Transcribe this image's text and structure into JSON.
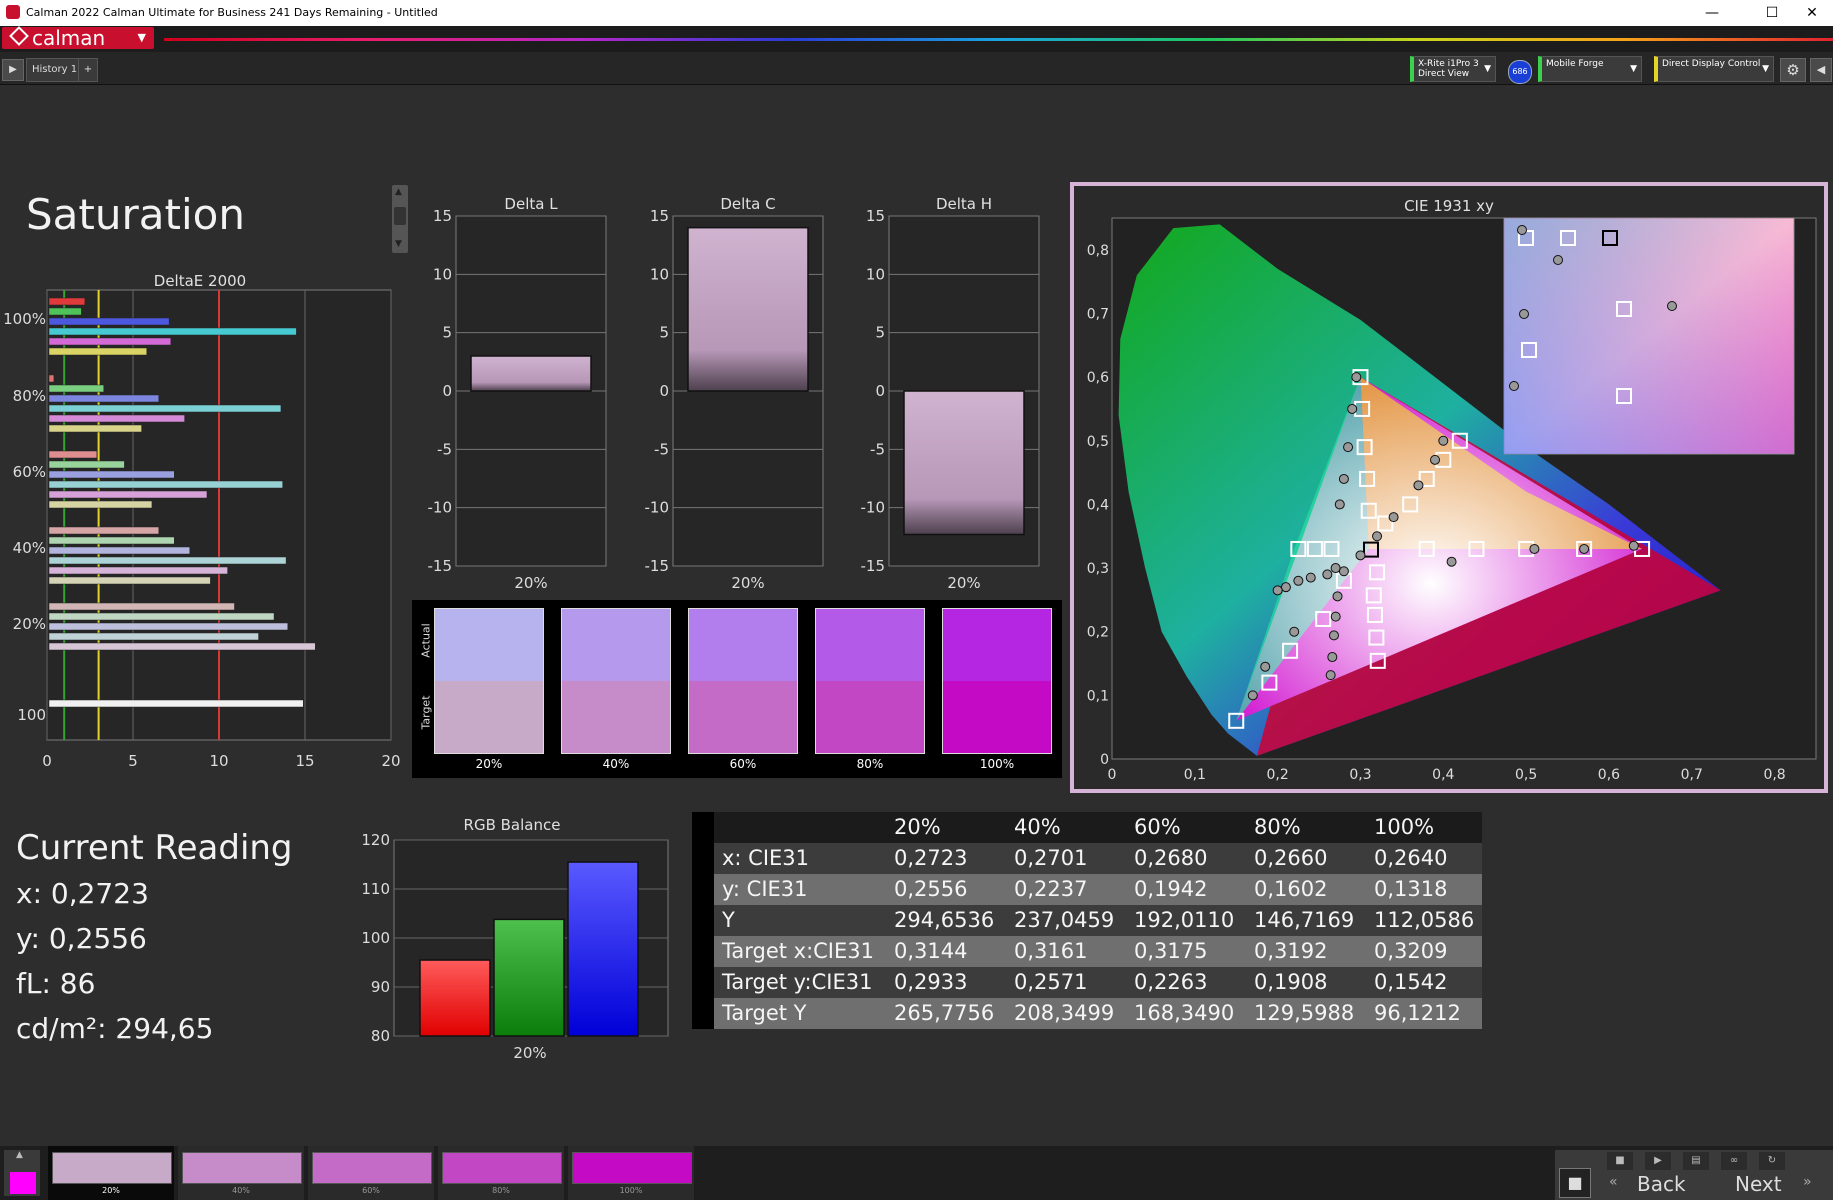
{
  "window": {
    "title": "Calman 2022 Calman Ultimate for Business 241 Days Remaining  - Untitled",
    "minimize": "—",
    "maximize": "☐",
    "close": "✕"
  },
  "brand": {
    "logo_text": "calman"
  },
  "tabs": {
    "history": "History 1",
    "add": "+"
  },
  "devices": {
    "meter_line1": "X-Rite i1Pro 3",
    "meter_line2": "Direct View",
    "meter_badge": "686",
    "source": "Mobile Forge",
    "display": "Direct Display Control"
  },
  "page": {
    "title": "Saturation"
  },
  "deltae": {
    "title": "DeltaE 2000",
    "xticks": [
      "0",
      "5",
      "10",
      "15",
      "20"
    ],
    "ylabels": [
      "100%",
      "80%",
      "60%",
      "40%",
      "20%",
      "100"
    ]
  },
  "delta_l": {
    "title": "Delta L",
    "label": "20%",
    "value": 3
  },
  "delta_c": {
    "title": "Delta C",
    "label": "20%",
    "value": 14
  },
  "delta_h": {
    "title": "Delta H",
    "label": "20%",
    "value": -12.3
  },
  "delta_axis": {
    "ticks": [
      "15",
      "10",
      "5",
      "0",
      "-5",
      "-10",
      "-15"
    ]
  },
  "swatches": {
    "actual_label": "Actual",
    "target_label": "Target",
    "items": [
      {
        "label": "20%",
        "actual": "#b7b3ee",
        "target": "#c6aac8"
      },
      {
        "label": "40%",
        "actual": "#b499ec",
        "target": "#c68cc9"
      },
      {
        "label": "60%",
        "actual": "#b27ded",
        "target": "#c46ac7"
      },
      {
        "label": "80%",
        "actual": "#b35ae9",
        "target": "#c247c4"
      },
      {
        "label": "100%",
        "actual": "#b526e3",
        "target": "#c40ac4"
      }
    ]
  },
  "cie": {
    "title": "CIE 1931 xy",
    "xticks": [
      "0",
      "0,1",
      "0,2",
      "0,3",
      "0,4",
      "0,5",
      "0,6",
      "0,7",
      "0,8"
    ],
    "yticks": [
      "0",
      "0,1",
      "0,2",
      "0,3",
      "0,4",
      "0,5",
      "0,6",
      "0,7",
      "0,8"
    ]
  },
  "current": {
    "title": "Current Reading",
    "x": "x: 0,2723",
    "y": "y: 0,2556",
    "fl": "fL: 86",
    "cdm": "cd/m²: 294,65"
  },
  "rgb": {
    "title": "RGB Balance",
    "label": "20%",
    "yticks": [
      "120",
      "110",
      "100",
      "90",
      "80"
    ],
    "ylim": [
      80,
      120
    ],
    "values": {
      "r": 95.5,
      "g": 103.8,
      "b": 115.5
    }
  },
  "table": {
    "headers": [
      "",
      "20%",
      "40%",
      "60%",
      "80%",
      "100%"
    ],
    "rows": [
      [
        "x: CIE31",
        "0,2723",
        "0,2701",
        "0,2680",
        "0,2660",
        "0,2640"
      ],
      [
        "y: CIE31",
        "0,2556",
        "0,2237",
        "0,1942",
        "0,1602",
        "0,1318"
      ],
      [
        "Y",
        "294,6536",
        "237,0459",
        "192,0110",
        "146,7169",
        "112,0586"
      ],
      [
        "Target x:CIE31",
        "0,3144",
        "0,3161",
        "0,3175",
        "0,3192",
        "0,3209"
      ],
      [
        "Target y:CIE31",
        "0,2933",
        "0,2571",
        "0,2263",
        "0,1908",
        "0,1542"
      ],
      [
        "Target Y",
        "265,7756",
        "208,3499",
        "168,3490",
        "129,5988",
        "96,1212"
      ]
    ]
  },
  "filmstrip": {
    "items": [
      {
        "label": "20%",
        "color": "#c6aac8"
      },
      {
        "label": "40%",
        "color": "#c68cc9"
      },
      {
        "label": "60%",
        "color": "#c46ac7"
      },
      {
        "label": "80%",
        "color": "#c247c4"
      },
      {
        "label": "100%",
        "color": "#c40ac4"
      }
    ]
  },
  "nav": {
    "back": "Back",
    "next": "Next"
  },
  "chart_data": [
    {
      "type": "bar",
      "title": "DeltaE 2000",
      "orientation": "horizontal",
      "xlim": [
        0,
        20
      ],
      "groups": [
        {
          "label": "100%",
          "values": [
            2.2,
            2.0,
            7.1,
            14.5,
            7.2,
            5.8
          ],
          "colors": [
            "#e03a3a",
            "#4fc35a",
            "#4c58e0",
            "#46c9d0",
            "#d36ad6",
            "#d9d465"
          ]
        },
        {
          "label": "80%",
          "values": [
            0.4,
            3.3,
            6.5,
            13.6,
            8.0,
            5.5
          ],
          "colors": [
            "#e07272",
            "#79cf7f",
            "#7d86df",
            "#7bd0d4",
            "#d48ad6",
            "#d8d48a"
          ]
        },
        {
          "label": "60%",
          "values": [
            2.9,
            4.5,
            7.4,
            13.7,
            9.3,
            6.1
          ],
          "colors": [
            "#de8e8e",
            "#97d39b",
            "#9aa0df",
            "#98d1d4",
            "#d6a1d8",
            "#d6d4a2"
          ]
        },
        {
          "label": "40%",
          "values": [
            6.5,
            7.4,
            8.3,
            13.9,
            10.5,
            9.5
          ],
          "colors": [
            "#d6a6a6",
            "#acd5b0",
            "#b1b4dc",
            "#acd3d6",
            "#d6b3d8",
            "#d5d3b5"
          ]
        },
        {
          "label": "20%",
          "values": [
            10.9,
            13.2,
            14.0,
            12.3,
            15.6
          ],
          "colors": [
            "#d2b6b6",
            "#bfd7c2",
            "#bdbfdc",
            "#bfd3d6",
            "#d6c6d6"
          ]
        },
        {
          "label": "100",
          "values": [
            14.9
          ],
          "colors": [
            "#f0f0f0"
          ]
        }
      ],
      "reference_lines": [
        {
          "x": 1,
          "color": "#33a533"
        },
        {
          "x": 3,
          "color": "#e3d42a"
        },
        {
          "x": 10,
          "color": "#d63838"
        }
      ]
    },
    {
      "type": "scatter",
      "title": "CIE 1931 xy",
      "xlim": [
        0,
        0.8
      ],
      "ylim": [
        0,
        0.8
      ],
      "series": [
        {
          "marker": "square-target",
          "points": [
            [
              0.3127,
              0.329
            ],
            [
              0.3,
              0.6
            ],
            [
              0.15,
              0.06
            ],
            [
              0.64,
              0.33
            ],
            [
              0.3144,
              0.2933
            ],
            [
              0.3161,
              0.2571
            ],
            [
              0.3175,
              0.2263
            ],
            [
              0.3192,
              0.1908
            ],
            [
              0.3209,
              0.1542
            ]
          ]
        },
        {
          "marker": "circle-measured",
          "points": [
            [
              0.2723,
              0.2556
            ],
            [
              0.2701,
              0.2237
            ],
            [
              0.268,
              0.1942
            ],
            [
              0.266,
              0.1602
            ],
            [
              0.264,
              0.1318
            ],
            [
              0.295,
              0.6
            ],
            [
              0.63,
              0.33
            ],
            [
              0.17,
              0.1
            ]
          ]
        }
      ]
    }
  ]
}
